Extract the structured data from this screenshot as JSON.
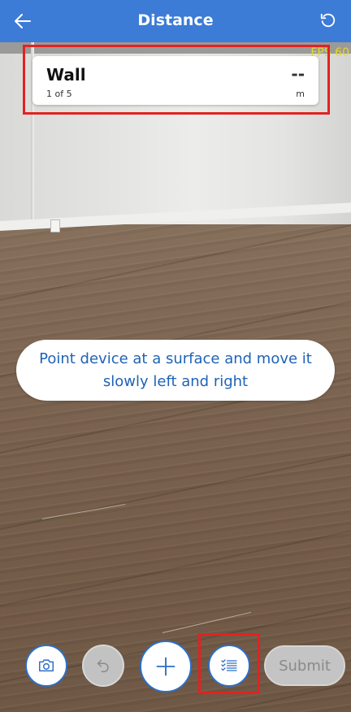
{
  "header": {
    "title": "Distance",
    "back_icon": "arrow-left-icon",
    "reset_icon": "rotate-ccw-icon",
    "background_color": "#3c7bd6"
  },
  "overlay": {
    "fps_text": "FPS 60"
  },
  "measurement_card": {
    "label": "Wall",
    "count_text": "1 of 5",
    "value": "--",
    "unit": "m"
  },
  "instruction": {
    "text": "Point device at a surface and move it slowly left and right"
  },
  "toolbar": {
    "camera_icon": "camera-icon",
    "undo_icon": "undo-icon",
    "add_icon": "plus-icon",
    "list_icon": "checklist-icon",
    "submit_label": "Submit",
    "accent_color": "#2d6fc7",
    "disabled_color": "#c4c4c4"
  },
  "highlight_color": "#e22222"
}
